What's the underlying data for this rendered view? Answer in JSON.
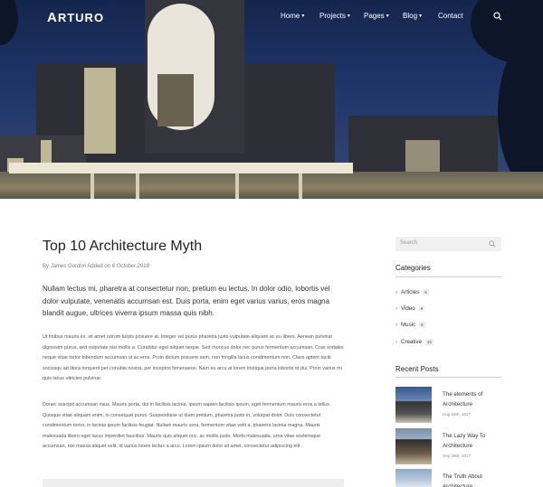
{
  "brand": {
    "logo_a": "A",
    "logo_rest": "RTURO"
  },
  "nav": [
    {
      "label": "Home",
      "chevron": "▾"
    },
    {
      "label": "Projects",
      "chevron": "▾"
    },
    {
      "label": "Pages",
      "chevron": "▾"
    },
    {
      "label": "Blog",
      "chevron": "▾"
    },
    {
      "label": "Contact",
      "chevron": ""
    }
  ],
  "article": {
    "title": "Top 10 Architecture Myth",
    "meta_by": "By",
    "author": "James Gordon",
    "meta_added": "Added on",
    "date": "6 October,2018",
    "lead": "Nullam lectus mi, pharetra at consectetur non, pretium eu lectus. In dolor odio, lobortis vel dolor vulputate, venenatis accumsan est. Duis porta, enim eget varius varius, eros magna blandit augue, ultrices viverra ipsum massa quis nibh.",
    "para1": "Ut finibus mauris ex, sit amet rutrum turpis posuere at. Integer vel purus pharetra justo vulputate aliquam ac eu libero. Aenean pulvinar dignissim purus, sed vulputate nisi mollis a. Curabitur eget aliquet neque. Sed rhoncus dolor nec purus fermentum accumsan. Cras sodales neque vitae tortor bibendum accumsan ut ac eros. Proin dictum posuere sem, non fringilla lacus condimentum non. Class aptent taciti sociosqu ad litora torquent per conubia nostra, per inceptos himenaeos. Nam eu arcu at lorem tristique porta lobortis et dui. Proin varius mi quis lacus ultricies pulvinar.",
    "para2": "Donec suscipit accumsan risus. Mauris porta, dui in facilisis lacinia, ipsum sapien facilisis ipsum, eget fermentum mauris eros a tellus. Quisque vitae aliquam enim, in consequat purus. Suspendisse ut diam pretium, pharetra justo in, volutpat dolor. Duis consectetur condimentum tortor, in lacinia ipsum facilisis feugiat. Nullam mauris urna, fermentum vitae velit a, pharetra lacinia magna. Mauris malesuada libero eget lacus imperdiet faucibus. Mauris quis aliquet orci, ac mollis justo. Morbi malesuada, urna vitae scelerisque accumsan, nisi massa aliquet velit, id varius lorem lectus a arcu. Lorem ipsum dolor sit amet, consectetur adipiscing elit."
  },
  "sidebar": {
    "search_placeholder": "Search",
    "categories_title": "Categories",
    "categories": [
      {
        "label": "Articles",
        "count": "5"
      },
      {
        "label": "Video",
        "count": "9"
      },
      {
        "label": "Music",
        "count": "8"
      },
      {
        "label": "Creative",
        "count": "10"
      }
    ],
    "recent_title": "Recent Posts",
    "posts": [
      {
        "title": "The elements of Architecture",
        "date": "Aug 16th, 2017"
      },
      {
        "title": "The Lazy Way To Architecture",
        "date": "Sep 29th, 2017"
      },
      {
        "title": "The Truth About Architecture",
        "date": ""
      }
    ]
  }
}
